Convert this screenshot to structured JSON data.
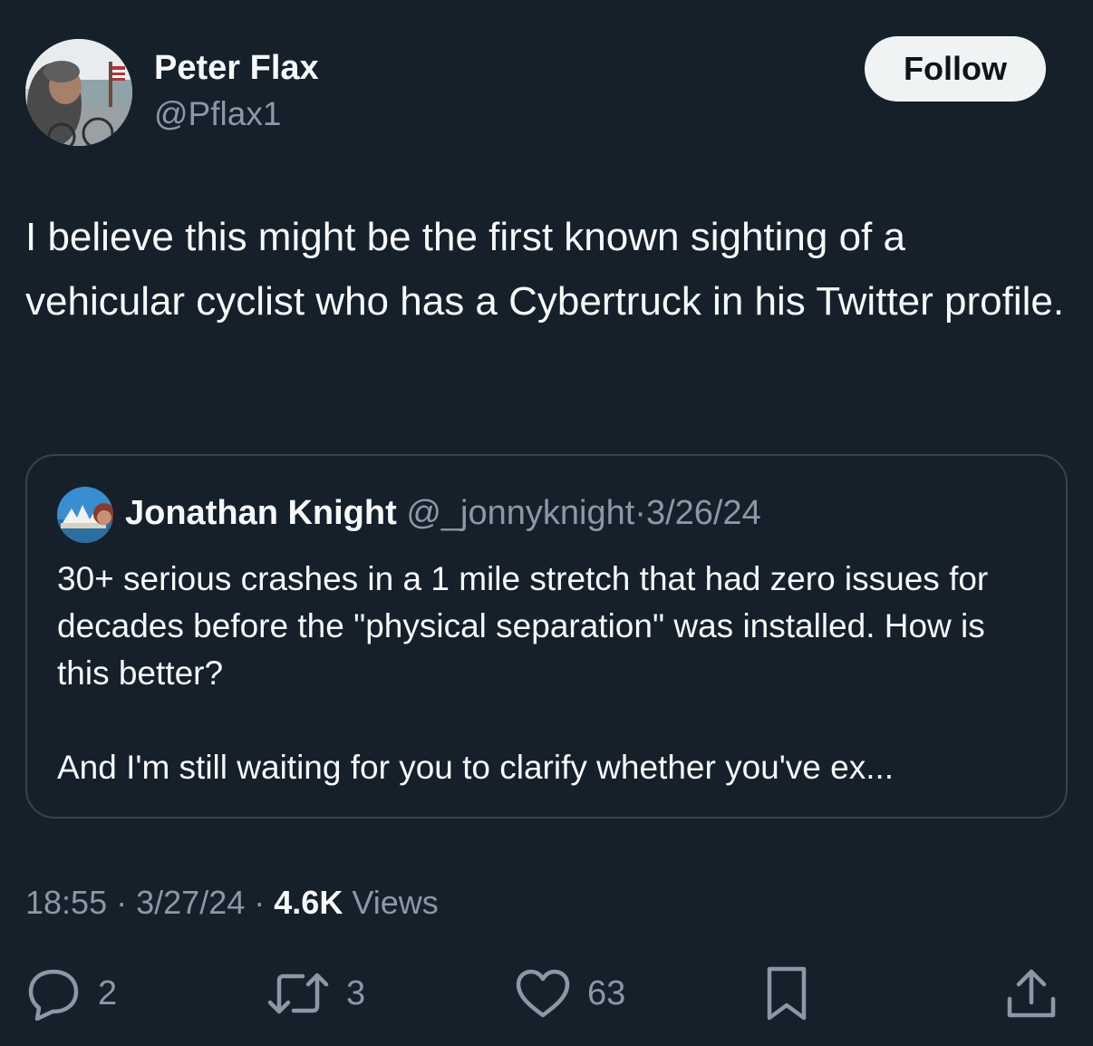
{
  "author": {
    "name": "Peter Flax",
    "handle": "@Pflax1"
  },
  "follow_label": "Follow",
  "tweet_text": "I believe this might be the first known sighting of a vehicular cyclist who has a Cybertruck in his Twitter profile.",
  "quoted": {
    "name": "Jonathan Knight",
    "handle": "@_jonnyknight",
    "separator": "·",
    "date": "3/26/24",
    "text_paragraph_1": "30+ serious crashes in a 1 mile stretch that had zero issues for decades before the \"physical separation\" was installed. How is this better?",
    "text_paragraph_2": "And I'm still waiting for you to clarify whether you've ex..."
  },
  "meta": {
    "time": "18:55",
    "separator": "·",
    "date": "3/27/24",
    "views_count": "4.6K",
    "views_label": "Views"
  },
  "actions": {
    "replies": "2",
    "reposts": "3",
    "likes": "63"
  },
  "icons": {
    "reply": "reply-icon",
    "repost": "repost-icon",
    "like": "heart-icon",
    "bookmark": "bookmark-icon",
    "share": "share-icon"
  },
  "colors": {
    "background": "#15202b",
    "primary_text": "#f7f9f9",
    "secondary_text": "#8b98a5",
    "border": "#38444d",
    "follow_button": "#eff3f4"
  }
}
